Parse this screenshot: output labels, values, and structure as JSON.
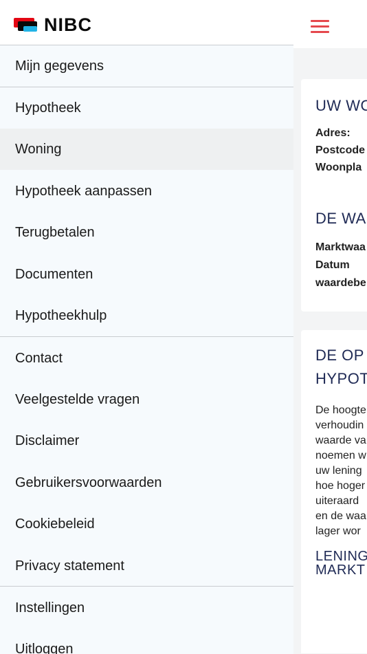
{
  "header": {
    "logo_text": "NIBC",
    "menu_icon": "hamburger-icon"
  },
  "menu": {
    "items": [
      "Mijn gegevens",
      "Hypotheek",
      "Woning",
      "Hypotheek aanpassen",
      "Terugbetalen",
      "Documenten",
      "Hypotheekhulp",
      "Contact",
      "Veelgestelde vragen",
      "Disclaimer",
      "Gebruikersvoorwaarden",
      "Cookiebeleid",
      "Privacy statement",
      "Instellingen",
      "Uitloggen"
    ],
    "active": "Woning"
  },
  "content": {
    "card1": {
      "title": "UW WO",
      "labels": [
        "Adres:",
        "Postcode",
        "Woonpla"
      ],
      "title2": "DE WA",
      "labels2": [
        "Marktwaa",
        "Datum",
        "waardebe"
      ]
    },
    "card2": {
      "title_lines": [
        "DE OP",
        "HYPOT"
      ],
      "paragraph_lines": [
        "De hoogte",
        "verhoudin",
        "waarde va",
        "noemen w",
        "uw lening",
        "hoe hoger",
        "uiteraard",
        "en de waa",
        "lager wor"
      ],
      "subtitle_lines": [
        "LENING",
        "MARKT"
      ]
    }
  },
  "colors": {
    "brand_red": "#e30613",
    "brand_blue": "#22b3e6",
    "heading_navy": "#1f2a55",
    "hamburger": "#e5484d"
  }
}
